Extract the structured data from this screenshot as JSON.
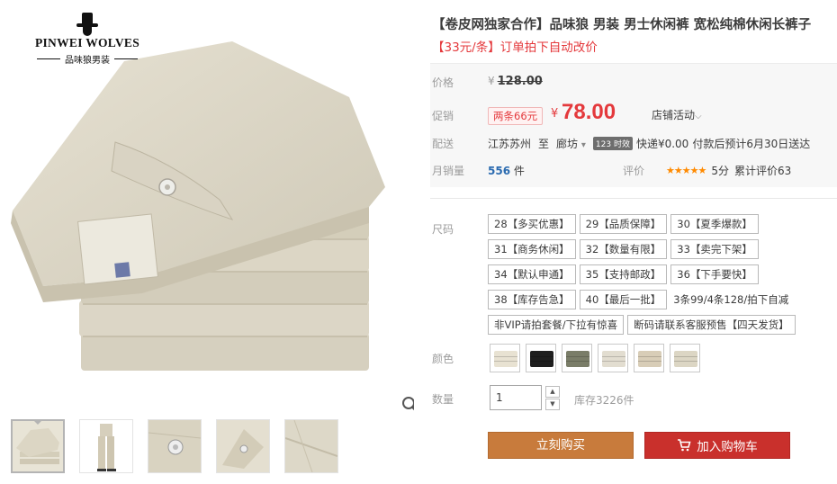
{
  "brand": {
    "name": "PINWEI WOLVES",
    "sub": "品味狼男装"
  },
  "product": {
    "title": "【卷皮网独家合作】品味狼 男装 男士休闲裤 宽松纯棉休闲长裤子",
    "subtitle": "【33元/条】订单拍下自动改价"
  },
  "price": {
    "label": "价格",
    "currency": "¥",
    "original": "128.00",
    "promo_label": "促销",
    "promo_tag": "两条66元",
    "promo_price": "78.00",
    "shop_activity": "店铺活动"
  },
  "shipping": {
    "label": "配送",
    "from": "江苏苏州",
    "to_word": "至",
    "destination": "廊坊",
    "badge": "123 时效",
    "fee": "快递¥0.00",
    "note": "付款后预计6月30日送达"
  },
  "sales": {
    "label": "月销量",
    "count": "556",
    "unit": "件",
    "review_label": "评价",
    "stars": "★★★★★",
    "score": "5分",
    "total_reviews": "累计评价63"
  },
  "sizes": {
    "label": "尺码",
    "options": [
      "28【多买优惠】",
      "29【品质保障】",
      "30【夏季爆款】",
      "31【商务休闲】",
      "32【数量有限】",
      "33【卖完下架】",
      "34【默认申通】",
      "35【支持邮政】",
      "36【下手要快】",
      "38【库存告急】",
      "40【最后一批】",
      "3条99/4条128/拍下自减",
      "非VIP请拍套餐/下拉有惊喜",
      "断码请联系客服预售【四天发货】"
    ]
  },
  "colors": {
    "label": "颜色",
    "swatches": [
      "#e8e2d2",
      "#1e1e1e",
      "#7a7d68",
      "#e2ddd0",
      "#d8cdb7",
      "#dcd6c4"
    ]
  },
  "quantity": {
    "label": "数量",
    "value": "1",
    "up": "▲",
    "down": "▼",
    "stock": "库存3226件"
  },
  "actions": {
    "buy_now": "立刻购买",
    "add_to_cart": "加入购物车"
  },
  "theme": {
    "accent_red": "#e4393c",
    "buy_orange": "#c87b3c",
    "cart_red": "#c9302c"
  }
}
